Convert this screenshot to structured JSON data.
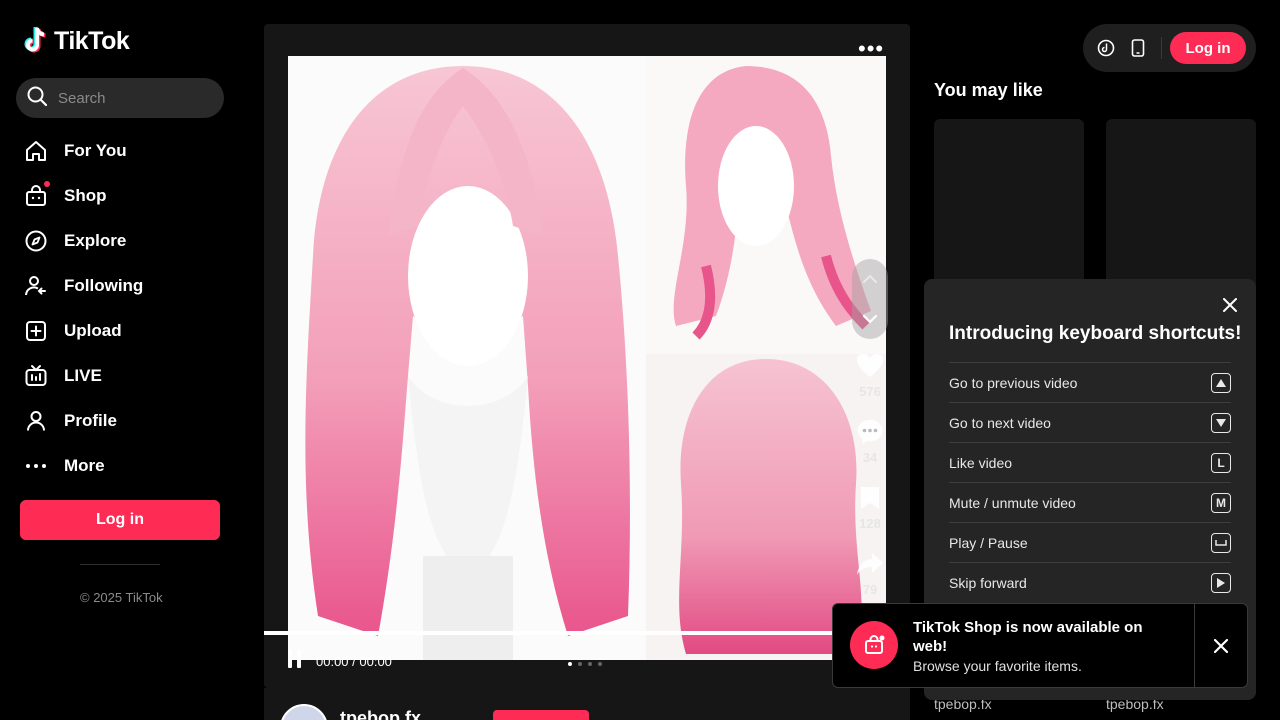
{
  "brand": {
    "name": "TikTok",
    "accent": "#fe2c55"
  },
  "search": {
    "placeholder": "Search",
    "icon": "search-icon"
  },
  "sidebar": {
    "items": [
      {
        "label": "For You",
        "icon": "home-icon"
      },
      {
        "label": "Shop",
        "icon": "shop-bag-icon"
      },
      {
        "label": "Explore",
        "icon": "compass-icon"
      },
      {
        "label": "Following",
        "icon": "following-icon"
      },
      {
        "label": "Upload",
        "icon": "upload-icon"
      },
      {
        "label": "LIVE",
        "icon": "live-icon"
      },
      {
        "label": "Profile",
        "icon": "profile-icon"
      },
      {
        "label": "More",
        "icon": "more-icon"
      }
    ],
    "login_label": "Log in",
    "copyright": "© 2025 TikTok"
  },
  "video": {
    "actions": [
      {
        "name": "like",
        "count": "576",
        "icon": "heart-icon"
      },
      {
        "name": "comment",
        "count": "34",
        "icon": "comment-icon"
      },
      {
        "name": "save",
        "count": "128",
        "icon": "bookmark-icon"
      },
      {
        "name": "share",
        "count": "79",
        "icon": "share-icon"
      }
    ],
    "time": "00:00 / 00:00",
    "progress": 1.0,
    "slides": 4,
    "active_slide": 1,
    "author": "tpebop.fx"
  },
  "topbar": {
    "login_label": "Log in"
  },
  "you_may_like": {
    "title": "You may like",
    "cards": [
      {
        "author": "tpebop.fx"
      },
      {
        "author": "tpebop.fx"
      }
    ]
  },
  "shortcuts": {
    "title": "Introducing keyboard shortcuts!",
    "rows": [
      {
        "label": "Go to previous video",
        "key": "▲"
      },
      {
        "label": "Go to next video",
        "key": "▼"
      },
      {
        "label": "Like video",
        "key": "L"
      },
      {
        "label": "Mute / unmute video",
        "key": "M"
      },
      {
        "label": "Play / Pause",
        "key": "␣"
      },
      {
        "label": "Skip forward",
        "key": "▶"
      }
    ]
  },
  "toast": {
    "title": "TikTok Shop is now available on web!",
    "subtitle": "Browse your favorite items."
  }
}
